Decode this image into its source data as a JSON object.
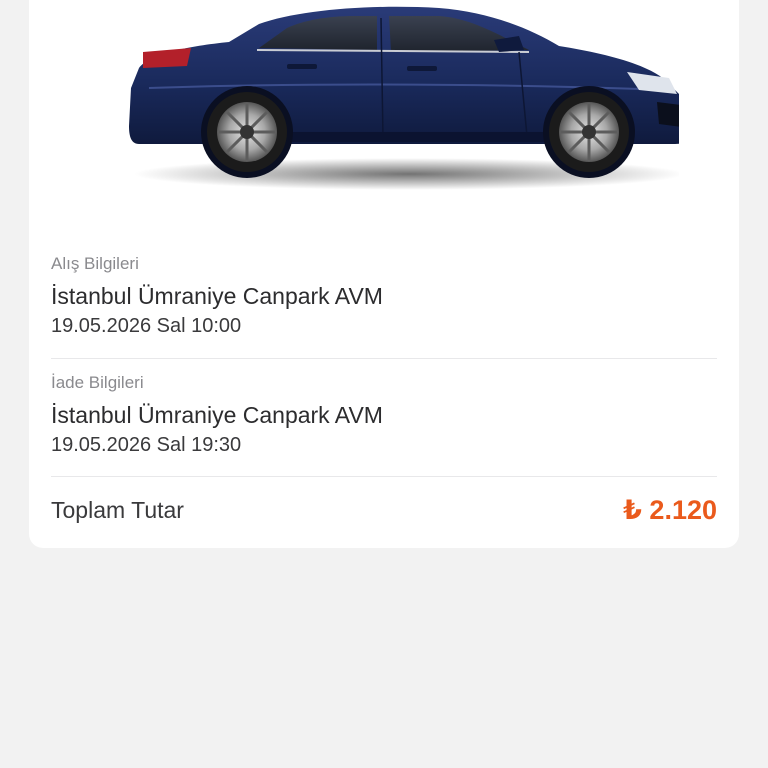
{
  "vehicle": {
    "image_icon": "car-image",
    "body_color": "#1a2a5c"
  },
  "pickup": {
    "label": "Alış Bilgileri",
    "location": "İstanbul Ümraniye Canpark AVM",
    "datetime": "19.05.2026 Sal 10:00"
  },
  "dropoff": {
    "label": "İade Bilgileri",
    "location": "İstanbul Ümraniye Canpark AVM",
    "datetime": "19.05.2026 Sal 19:30"
  },
  "total": {
    "label": "Toplam Tutar",
    "value": "₺ 2.120",
    "accent_color": "#ea5a1c"
  }
}
